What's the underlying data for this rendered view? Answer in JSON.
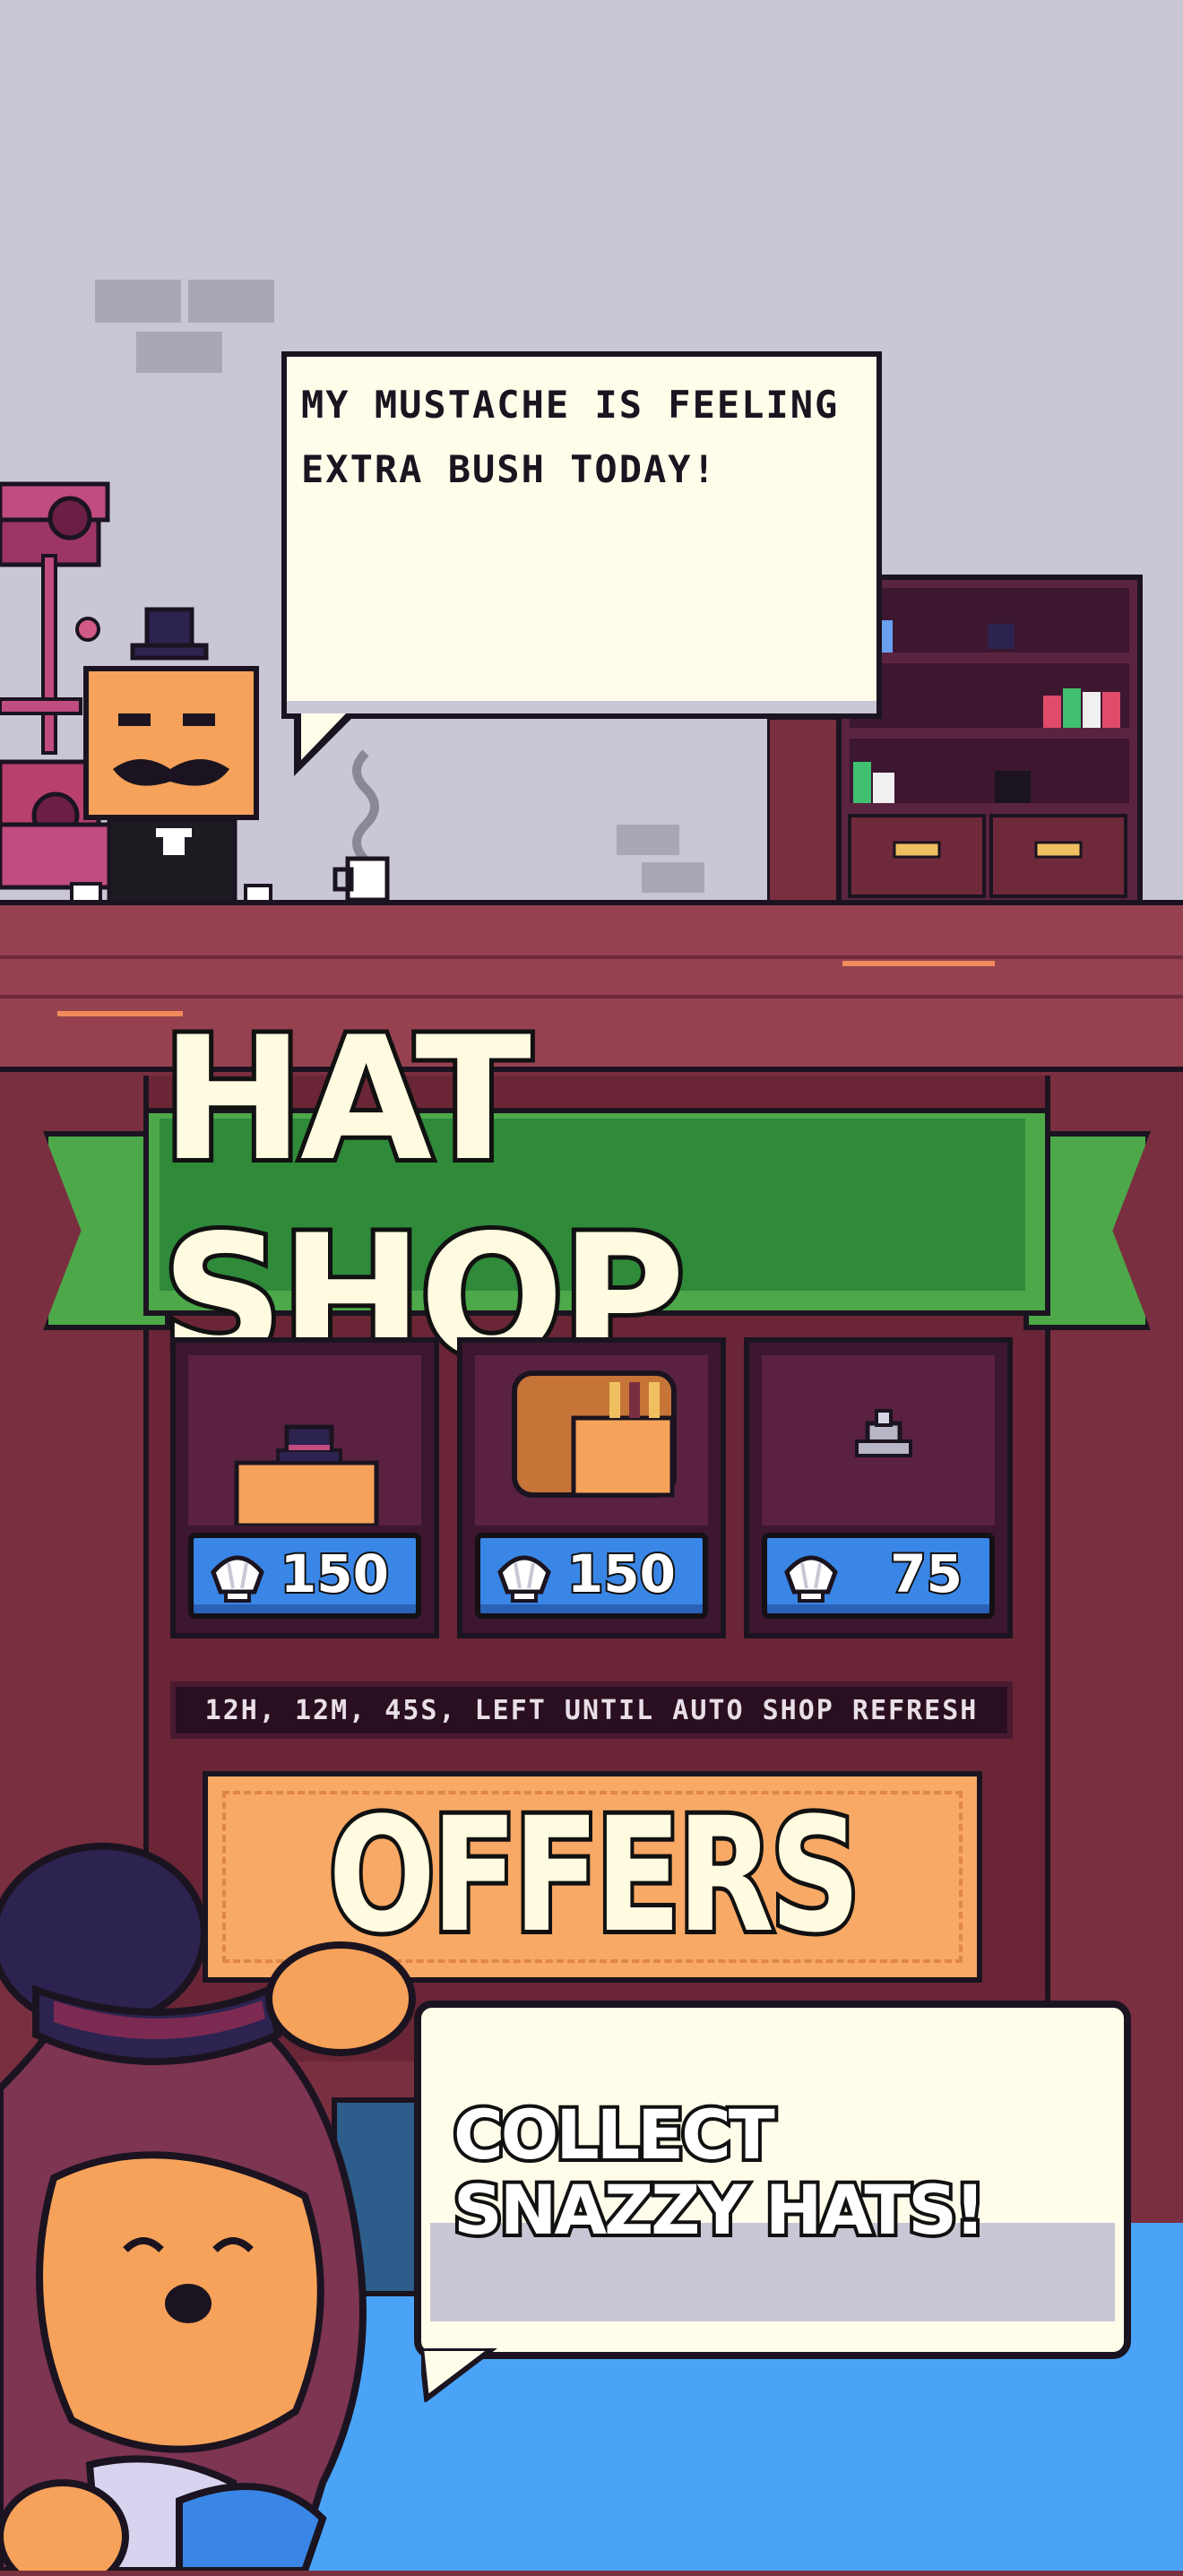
{
  "npc": {
    "speech": "MY MUSTACHE IS FEELING EXTRA BUSH TODAY!"
  },
  "shop": {
    "title": "HAT SHOP",
    "items": [
      {
        "name": "top-hat-box",
        "price": "150"
      },
      {
        "name": "bread-hat",
        "price": "150"
      },
      {
        "name": "tiny-helmet",
        "price": "75"
      }
    ],
    "refresh_text": "12H, 12M, 45S, LEFT UNTIL AUTO SHOP REFRESH",
    "offers_label": "OFFERS"
  },
  "promo": {
    "caption": "COLLECT SNAZZY HATS!"
  },
  "colors": {
    "banner_green": "#4da84a",
    "price_blue": "#3a86e6",
    "offers_orange": "#f8a965",
    "board_maroon": "#7a2f40"
  }
}
